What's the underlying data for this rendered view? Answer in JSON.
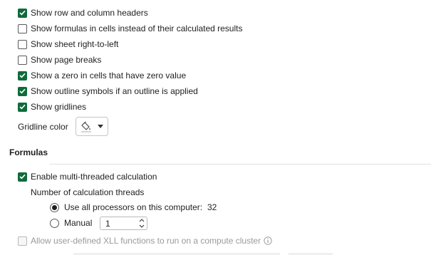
{
  "display_options": {
    "show_headers": {
      "label": "Show row and column headers",
      "checked": true
    },
    "show_formulas": {
      "label": "Show formulas in cells instead of their calculated results",
      "checked": false
    },
    "show_rtl": {
      "label": "Show sheet right-to-left",
      "checked": false
    },
    "show_page_breaks": {
      "label": "Show page breaks",
      "checked": false
    },
    "show_zero": {
      "label": "Show a zero in cells that have zero value",
      "checked": true
    },
    "show_outline": {
      "label": "Show outline symbols if an outline is applied",
      "checked": true
    },
    "show_gridlines": {
      "label": "Show gridlines",
      "checked": true
    },
    "gridline_color_label": "Gridline color"
  },
  "formulas": {
    "title": "Formulas",
    "multithreaded": {
      "label": "Enable multi-threaded calculation",
      "checked": true
    },
    "threads_label": "Number of calculation threads",
    "use_all": {
      "label": "Use all processors on this computer:",
      "value": "32",
      "selected": true
    },
    "manual": {
      "label": "Manual",
      "value": "1",
      "selected": false
    },
    "xll": {
      "label": "Allow user-defined XLL functions to run on a compute cluster",
      "checked": false,
      "disabled": true
    }
  },
  "icons": {
    "check": "check-icon",
    "paint_bucket": "paint-bucket-icon",
    "info": "info-icon"
  },
  "colors": {
    "accent": "#0f6b3a",
    "text": "#1f1f1f",
    "disabled": "#9a9a9a"
  }
}
